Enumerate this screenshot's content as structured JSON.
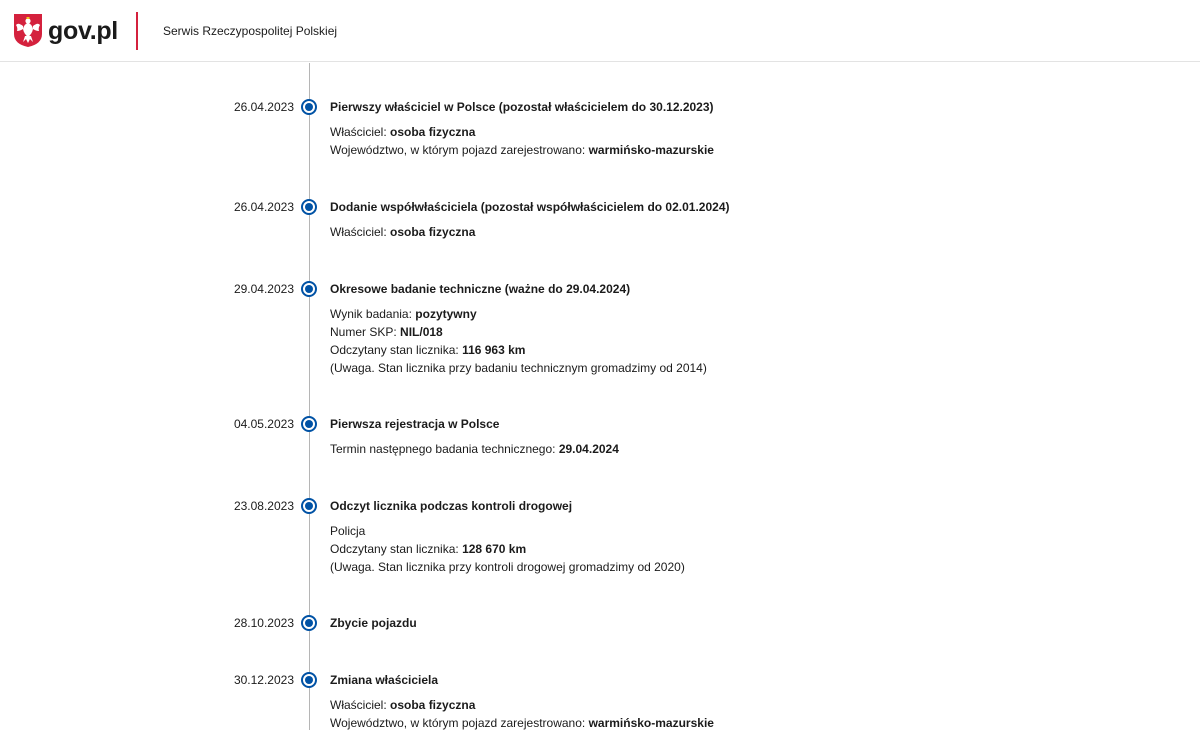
{
  "header": {
    "brand": "gov.pl",
    "service": "Serwis Rzeczypospolitej Polskiej",
    "accent_color": "#d4213d"
  },
  "timeline": {
    "accent_color": "#0052a5",
    "events": [
      {
        "date": "26.04.2023",
        "title": "Pierwszy właściciel w Polsce (pozostał właścicielem do 30.12.2023)",
        "details": [
          {
            "label": "Właściciel: ",
            "value": "osoba fizyczna"
          },
          {
            "label": "Województwo, w którym pojazd zarejestrowano: ",
            "value": "warmińsko-mazurskie"
          }
        ]
      },
      {
        "date": "26.04.2023",
        "title": "Dodanie współwłaściciela (pozostał współwłaścicielem do 02.01.2024)",
        "details": [
          {
            "label": "Właściciel: ",
            "value": "osoba fizyczna"
          }
        ]
      },
      {
        "date": "29.04.2023",
        "title": "Okresowe badanie techniczne (ważne do 29.04.2024)",
        "details": [
          {
            "label": "Wynik badania: ",
            "value": "pozytywny"
          },
          {
            "label": "Numer SKP: ",
            "value": "NIL/018"
          },
          {
            "label": "Odczytany stan licznika: ",
            "value": "116 963 km"
          },
          {
            "label": "(Uwaga. Stan licznika przy badaniu technicznym gromadzimy od 2014)",
            "value": ""
          }
        ]
      },
      {
        "date": "04.05.2023",
        "title": "Pierwsza rejestracja w Polsce",
        "details": [
          {
            "label": "Termin następnego badania technicznego: ",
            "value": "29.04.2024"
          }
        ]
      },
      {
        "date": "23.08.2023",
        "title": "Odczyt licznika podczas kontroli drogowej",
        "details": [
          {
            "label": "Policja",
            "value": ""
          },
          {
            "label": "Odczytany stan licznika: ",
            "value": "128 670 km"
          },
          {
            "label": "(Uwaga. Stan licznika przy kontroli drogowej gromadzimy od 2020)",
            "value": ""
          }
        ]
      },
      {
        "date": "28.10.2023",
        "title": "Zbycie pojazdu",
        "details": []
      },
      {
        "date": "30.12.2023",
        "title": "Zmiana właściciela",
        "details": [
          {
            "label": "Właściciel: ",
            "value": "osoba fizyczna"
          },
          {
            "label": "Województwo, w którym pojazd zarejestrowano: ",
            "value": "warmińsko-mazurskie"
          }
        ]
      }
    ]
  }
}
